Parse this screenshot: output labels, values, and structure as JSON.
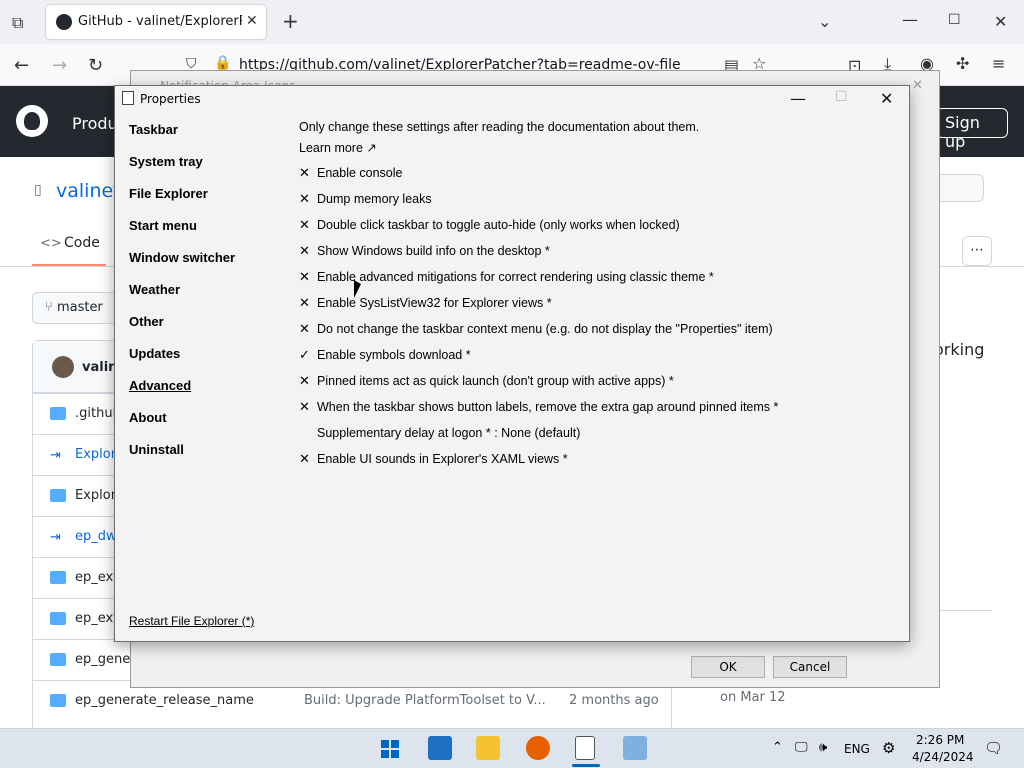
{
  "browser": {
    "tab_title": "GitHub - valinet/ExplorerPatcher",
    "new_tab": "+",
    "url": "https://github.com/valinet/ExplorerPatcher?tab=readme-ov-file",
    "controls": {
      "minimize": "—",
      "maximize": "☐",
      "close": "✕"
    }
  },
  "github": {
    "product": "Produ",
    "signup": "Sign up",
    "repo": "valinet",
    "code_tab": "Code",
    "branch": "master",
    "owner": "valine",
    "files": [
      {
        "name": ".github",
        "kind": "folder"
      },
      {
        "name": "Explore",
        "kind": "submodule"
      },
      {
        "name": "Explore",
        "kind": "folder"
      },
      {
        "name": "ep_dw",
        "kind": "submodule"
      },
      {
        "name": "ep_ext",
        "kind": "folder"
      },
      {
        "name": "ep_ext",
        "kind": "folder"
      },
      {
        "name": "ep_gener",
        "kind": "folder"
      },
      {
        "name": "ep_generate_release_name",
        "kind": "folder",
        "message": "Build: Upgrade PlatformToolset to V...",
        "age": "2 months ago"
      }
    ],
    "side_text": "orking",
    "side_date": "on Mar 12"
  },
  "back_dialog": {
    "title": "Notification Area Icons",
    "ok": "OK",
    "cancel": "Cancel"
  },
  "properties": {
    "title": "Properties",
    "nav": [
      "Taskbar",
      "System tray",
      "File Explorer",
      "Start menu",
      "Window switcher",
      "Weather",
      "Other",
      "Updates",
      "Advanced",
      "About",
      "Uninstall"
    ],
    "active_nav": "Advanced",
    "intro": "Only change these settings after reading the documentation about them.",
    "learn_more": "Learn more ↗",
    "options": [
      {
        "mark": "✕",
        "label": "Enable console"
      },
      {
        "mark": "✕",
        "label": "Dump memory leaks"
      },
      {
        "mark": "✕",
        "label": "Double click taskbar to toggle auto-hide (only works when locked)"
      },
      {
        "mark": "✕",
        "label": "Show Windows build info on the desktop *"
      },
      {
        "mark": "✕",
        "label": "Enable advanced mitigations for correct rendering using classic theme *"
      },
      {
        "mark": "✕",
        "label": "Enable SysListView32 for Explorer views *"
      },
      {
        "mark": "✕",
        "label": "Do not change the taskbar context menu (e.g. do not display the \"Properties\" item)"
      },
      {
        "mark": "✓",
        "label": "Enable symbols download *"
      },
      {
        "mark": "✕",
        "label": "Pinned items act as quick launch (don't group with active apps) *"
      },
      {
        "mark": "✕",
        "label": "When the taskbar shows button labels, remove the extra gap around pinned items *"
      },
      {
        "mark": "",
        "label": "Supplementary delay at logon * : None (default)"
      },
      {
        "mark": "✕",
        "label": "Enable UI sounds in Explorer's XAML views *"
      }
    ],
    "restart": "Restart File Explorer (*)"
  },
  "taskbar": {
    "language": "ENG",
    "time": "2:26 PM",
    "date": "4/24/2024"
  }
}
